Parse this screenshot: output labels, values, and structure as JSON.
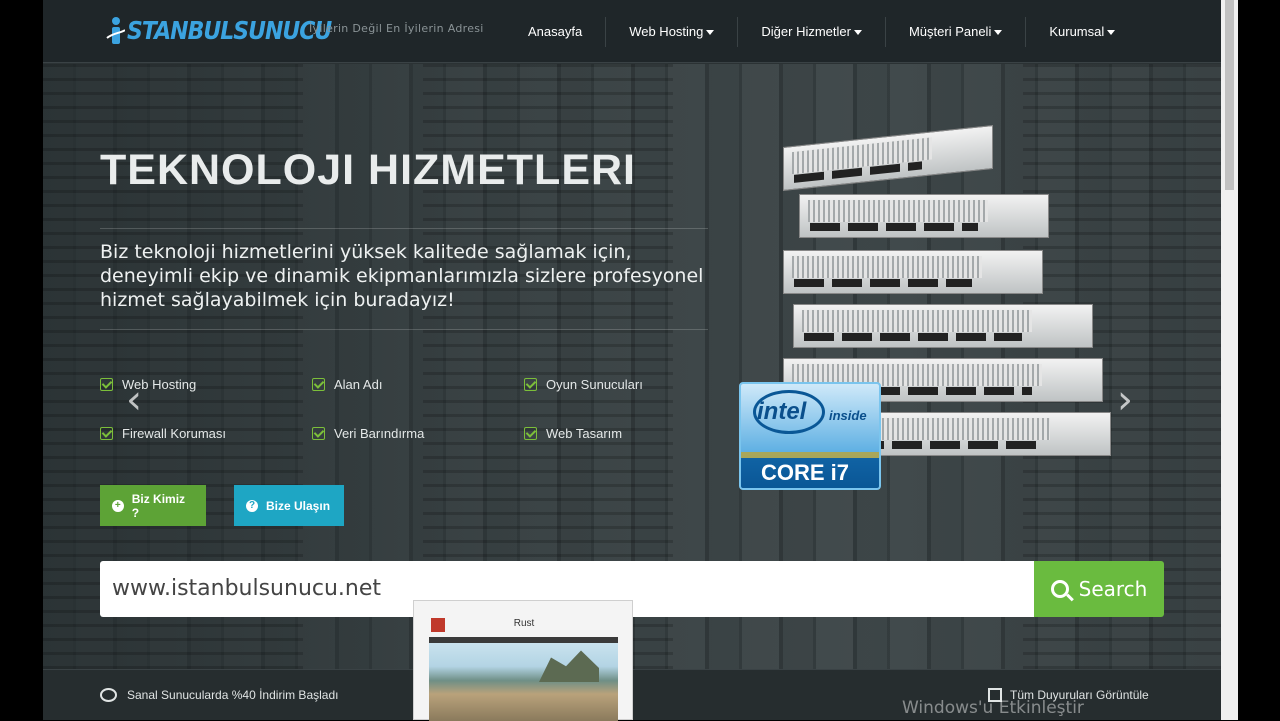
{
  "header": {
    "logo_text": "STANBULSUNUCU",
    "tagline": "İyilerin Değil En İyilerin Adresi",
    "nav": [
      {
        "label": "Anasayfa",
        "dropdown": false
      },
      {
        "label": "Web Hosting",
        "dropdown": true
      },
      {
        "label": "Diğer Hizmetler",
        "dropdown": true
      },
      {
        "label": "Müşteri Paneli",
        "dropdown": true
      },
      {
        "label": "Kurumsal",
        "dropdown": true
      }
    ]
  },
  "hero": {
    "title": "TEKNOLOJI HIZMETLERI",
    "description": "Biz teknoloji hizmetlerini yüksek kalitede sağlamak için, deneyimli ekip ve dinamik ekipmanlarımızla sizlere profesyonel hizmet sağlayabilmek için buradayız!",
    "features": [
      "Web Hosting",
      "Alan Adı",
      "Oyun Sunucuları",
      "Firewall Koruması",
      "Veri Barındırma",
      "Web Tasarım"
    ],
    "buttons": {
      "about": "Biz Kimiz ?",
      "contact": "Bize Ulaşın"
    },
    "prev_arrow": "‹",
    "next_arrow": "›",
    "badge": {
      "brand": "intel",
      "inside": "inside",
      "model": "CORE i7"
    }
  },
  "search": {
    "value": "www.istanbulsunucu.net",
    "button_label": "Search"
  },
  "announcements": {
    "latest": "Sanal Sunucularda %40 İndirim Başladı",
    "all_label": "Tüm Duyuruları Görüntüle"
  },
  "taskbar_preview": {
    "title": "Rust"
  },
  "watermark": "Windows'u Etkinleştir",
  "colors": {
    "accent_green": "#6abb3f",
    "accent_cyan": "#1ea6c4",
    "logo_blue": "#3ba3e0",
    "header_bg": "#1f2629"
  }
}
